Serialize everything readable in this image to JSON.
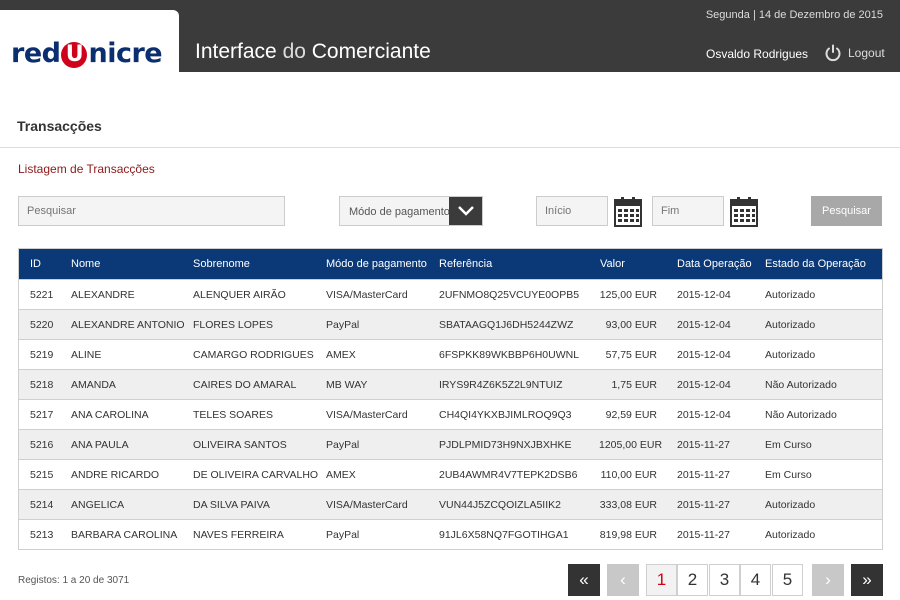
{
  "brand": {
    "logo_pre": "red",
    "logo_u": "U",
    "logo_post": "nicre"
  },
  "header": {
    "title_strong_1": "Interface ",
    "title_thin": "do",
    "title_strong_2": " Comerciante",
    "date": "Segunda | 14 de Dezembro de 2015",
    "user": "Osvaldo Rodrigues",
    "logout": "Logout"
  },
  "page": {
    "title": "Transacções",
    "section": "Listagem de Transacções"
  },
  "filters": {
    "search_placeholder": "Pesquisar",
    "payment_method": "Módo de pagamento",
    "start_placeholder": "Início",
    "end_placeholder": "Fim",
    "search_button": "Pesquisar"
  },
  "table": {
    "headers": [
      "ID",
      "Nome",
      "Sobrenome",
      "Módo de pagamento",
      "Referência",
      "Valor",
      "Data Operação",
      "Estado da Operação"
    ],
    "rows": [
      [
        "5221",
        "ALEXANDRE",
        "ALENQUER AIRÃO",
        "VISA/MasterCard",
        "2UFNMO8Q25VCUYE0OPB5",
        "125,00 EUR",
        "2015-12-04",
        "Autorizado"
      ],
      [
        "5220",
        "ALEXANDRE ANTONIO",
        "FLORES LOPES",
        "PayPal",
        "SBATAAGQ1J6DH5244ZWZ",
        "93,00 EUR",
        "2015-12-04",
        "Autorizado"
      ],
      [
        "5219",
        "ALINE",
        "CAMARGO RODRIGUES",
        "AMEX",
        "6FSPKK89WKBBP6H0UWNL",
        "57,75 EUR",
        "2015-12-04",
        "Autorizado"
      ],
      [
        "5218",
        "AMANDA",
        "CAIRES DO AMARAL",
        "MB WAY",
        "IRYS9R4Z6K5Z2L9NTUIZ",
        "1,75 EUR",
        "2015-12-04",
        "Não Autorizado"
      ],
      [
        "5217",
        "ANA CAROLINA",
        "TELES SOARES",
        "VISA/MasterCard",
        "CH4QI4YKXBJIMLROQ9Q3",
        "92,59 EUR",
        "2015-12-04",
        "Não Autorizado"
      ],
      [
        "5216",
        "ANA PAULA",
        "OLIVEIRA SANTOS",
        "PayPal",
        "PJDLPMID73H9NXJBXHKE",
        "1205,00 EUR",
        "2015-11-27",
        "Em Curso"
      ],
      [
        "5215",
        "ANDRE RICARDO",
        "DE OLIVEIRA CARVALHO",
        "AMEX",
        "2UB4AWMR4V7TEPK2DSB6",
        "110,00 EUR",
        "2015-11-27",
        "Em Curso"
      ],
      [
        "5214",
        "ANGELICA",
        "DA SILVA PAIVA",
        "VISA/MasterCard",
        "VUN44J5ZCQOIZLA5IIK2",
        "333,08 EUR",
        "2015-11-27",
        "Autorizado"
      ],
      [
        "5213",
        "BARBARA CAROLINA",
        "NAVES FERREIRA",
        "PayPal",
        "91JL6X58NQ7FGOTIHGA1",
        "819,98 EUR",
        "2015-11-27",
        "Autorizado"
      ]
    ]
  },
  "footer": {
    "records": "Registos: 1 a 20 de 3071",
    "pages": [
      "1",
      "2",
      "3",
      "4",
      "5"
    ],
    "active_page": "1",
    "first": "«",
    "prev": "‹",
    "next": "›",
    "last": "»"
  }
}
